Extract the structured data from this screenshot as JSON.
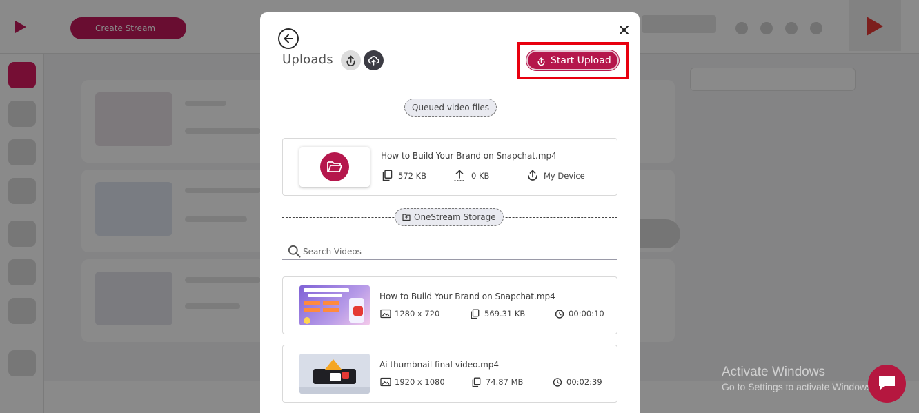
{
  "background_app": {
    "top_button_label": "Create Stream"
  },
  "modal": {
    "title": "Uploads",
    "start_upload_label": "Start Upload",
    "queued_label": "Queued video files",
    "storage_label": "OneStream Storage",
    "search_placeholder": "Search Videos",
    "queued_files": [
      {
        "name": "How to Build Your Brand on Snapchat.mp4",
        "size": "572 KB",
        "uploaded": "0 KB",
        "source": "My Device"
      }
    ],
    "storage_videos": [
      {
        "name": "How to Build Your Brand on Snapchat.mp4",
        "resolution": "1280 x 720",
        "size": "569.31 KB",
        "duration": "00:00:10"
      },
      {
        "name": "Ai thumbnail final video.mp4",
        "resolution": "1920 x 1080",
        "size": "74.87 MB",
        "duration": "00:02:39"
      }
    ]
  },
  "watermark": {
    "title": "Activate Windows",
    "subtitle": "Go to Settings to activate Windows."
  },
  "colors": {
    "brand": "#b5174c",
    "highlight": "#e8000f"
  },
  "icons": [
    "back-arrow-icon",
    "upload-icon",
    "cloud-upload-icon",
    "close-icon",
    "folder-open-icon",
    "copy-icon",
    "upload-arrow-icon",
    "search-icon",
    "image-icon",
    "timer-icon",
    "chat-icon"
  ]
}
